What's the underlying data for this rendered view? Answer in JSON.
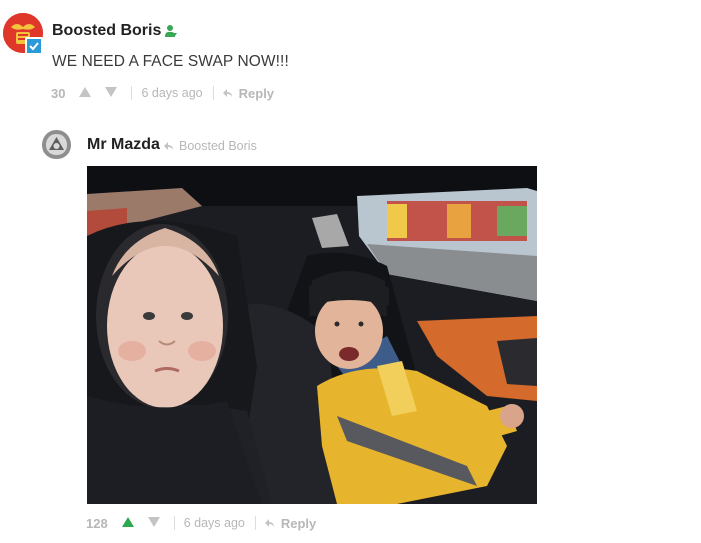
{
  "comments": [
    {
      "author": "Boosted Boris",
      "body": "WE NEED A FACE SWAP NOW!!!",
      "votes": "30",
      "timestamp": "6 days ago",
      "reply_label": "Reply",
      "avatar_color": "#e0372b",
      "verified_color": "#2b9ad8",
      "staff_color": "#3aa757"
    },
    {
      "author": "Mr Mazda",
      "replying_to": "Boosted Boris",
      "votes": "128",
      "timestamp": "6 days ago",
      "reply_label": "Reply",
      "upvoted": true,
      "upvote_color": "#2fa84f",
      "attachment": "face-swap-photo"
    }
  ],
  "colors": {
    "text_primary": "#222222",
    "text_muted": "#b7b7b7"
  }
}
